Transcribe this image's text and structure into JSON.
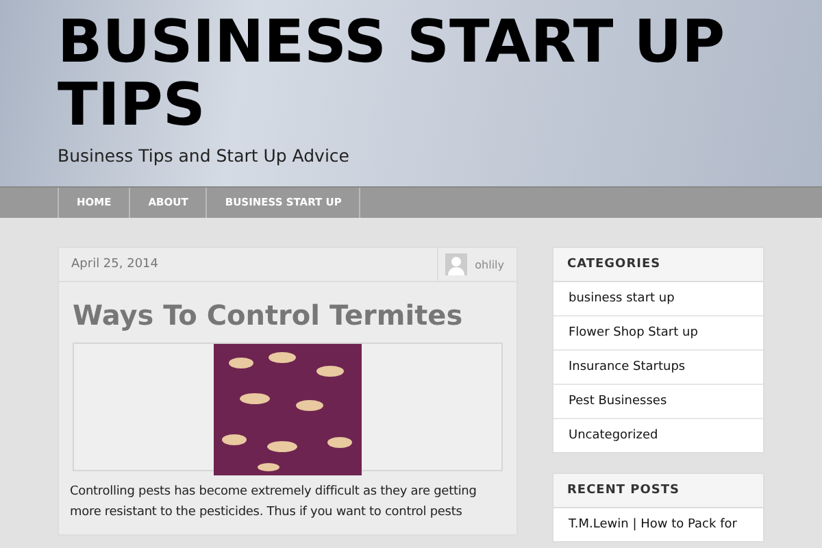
{
  "site": {
    "title": "BUSINESS START UP TIPS",
    "tagline": "Business Tips and Start Up Advice"
  },
  "nav": [
    {
      "label": "HOME"
    },
    {
      "label": "ABOUT"
    },
    {
      "label": "BUSINESS START UP"
    }
  ],
  "post": {
    "date": "April 25, 2014",
    "author": "ohlily",
    "title": "Ways To Control Termites",
    "body": "Controlling pests has become extremely difficult as they are getting more resistant to the pesticides. Thus if you want to control pests"
  },
  "sidebar": [
    {
      "heading": "CATEGORIES",
      "items": [
        "business start up",
        "Flower Shop Start up",
        "Insurance Startups",
        "Pest Businesses",
        "Uncategorized"
      ]
    },
    {
      "heading": "RECENT POSTS",
      "items": [
        "T.M.Lewin | How to Pack for"
      ]
    }
  ]
}
